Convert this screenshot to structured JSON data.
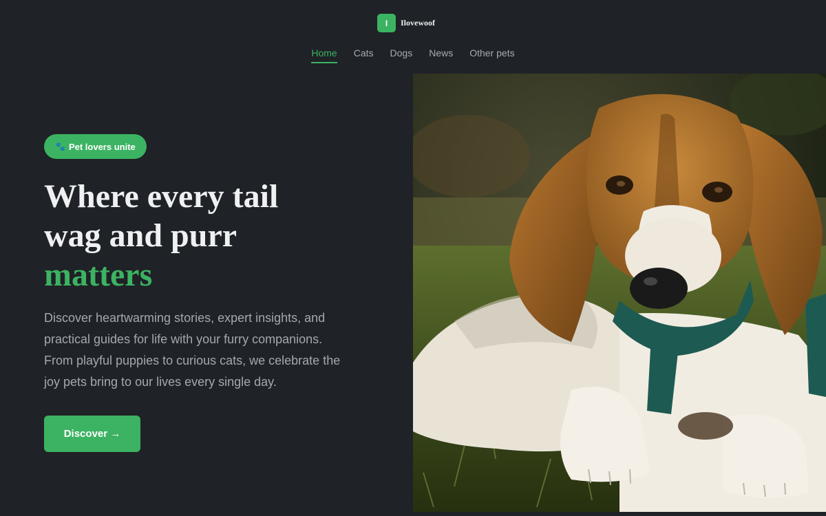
{
  "brand": {
    "logo_letter": "I",
    "name": "Ilovewoof"
  },
  "nav": {
    "items": [
      {
        "label": "Home",
        "active": true
      },
      {
        "label": "Cats",
        "active": false
      },
      {
        "label": "Dogs",
        "active": false
      },
      {
        "label": "News",
        "active": false
      },
      {
        "label": "Other pets",
        "active": false
      }
    ]
  },
  "hero": {
    "badge_icon": "paw-icon",
    "badge_icon_glyph": "🐾",
    "badge": "Pet lovers unite",
    "headline": {
      "line1": "Where every tail",
      "line2": "wag and purr",
      "accent": "matters"
    },
    "description": "Discover heartwarming stories, expert insights, and practical guides for life with your furry companions. From playful puppies to curious cats, we celebrate the joy pets bring to our lives every single day.",
    "cta": "Discover →",
    "image_subject": "beagle puppy lying on grass"
  },
  "colors": {
    "background": "#1f2226",
    "accent": "#3cb362",
    "heading": "#eef0f2",
    "body_text": "#a3a9b0",
    "nav_text": "#a7acb2"
  }
}
